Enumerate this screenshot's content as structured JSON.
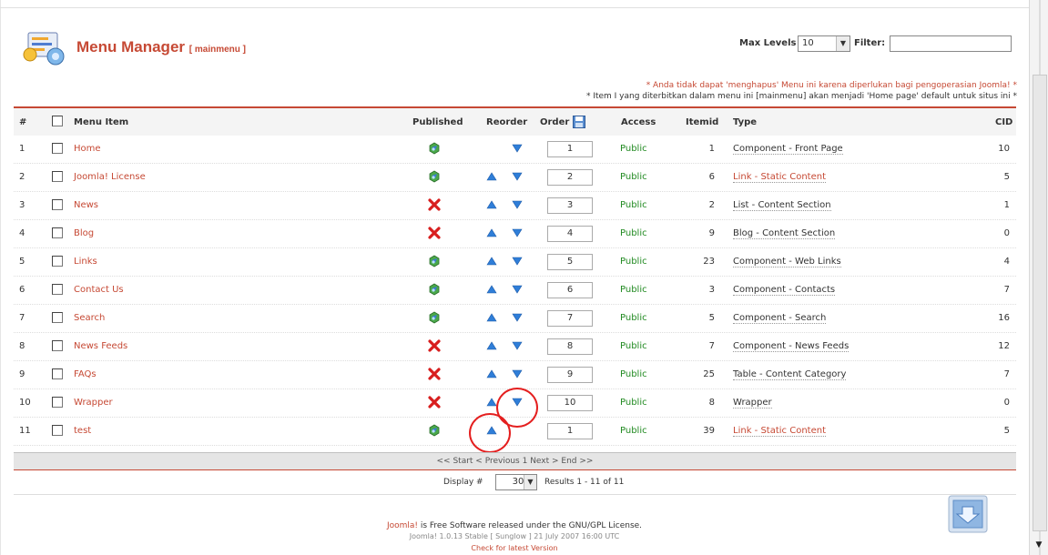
{
  "header": {
    "title": "Menu Manager",
    "subtitle": "[ mainmenu ]",
    "max_levels_label": "Max Levels",
    "max_levels_value": "10",
    "filter_label": "Filter:",
    "filter_value": ""
  },
  "notices": {
    "red": "* Anda tidak dapat 'menghapus' Menu ini karena diperlukan bagi pengoperasian Joomla! *",
    "dark": "* Item I yang diterbitkan dalam menu ini [mainmenu] akan menjadi 'Home page' default untuk situs ini *"
  },
  "columns": {
    "num": "#",
    "item": "Menu Item",
    "published": "Published",
    "reorder": "Reorder",
    "order": "Order",
    "access": "Access",
    "itemid": "Itemid",
    "type": "Type",
    "cid": "CID"
  },
  "rows": [
    {
      "num": "1",
      "name": "Home",
      "published": "yes",
      "up": false,
      "down": true,
      "order": "1",
      "access": "Public",
      "itemid": "1",
      "type": "Component - Front Page",
      "type_link": false,
      "cid": "10"
    },
    {
      "num": "2",
      "name": "Joomla! License",
      "published": "yes",
      "up": true,
      "down": true,
      "order": "2",
      "access": "Public",
      "itemid": "6",
      "type": "Link - Static Content",
      "type_link": true,
      "cid": "5"
    },
    {
      "num": "3",
      "name": "News",
      "published": "no",
      "up": true,
      "down": true,
      "order": "3",
      "access": "Public",
      "itemid": "2",
      "type": "List - Content Section",
      "type_link": false,
      "cid": "1"
    },
    {
      "num": "4",
      "name": "Blog",
      "published": "no",
      "up": true,
      "down": true,
      "order": "4",
      "access": "Public",
      "itemid": "9",
      "type": "Blog - Content Section",
      "type_link": false,
      "cid": "0"
    },
    {
      "num": "5",
      "name": "Links",
      "published": "yes",
      "up": true,
      "down": true,
      "order": "5",
      "access": "Public",
      "itemid": "23",
      "type": "Component - Web Links",
      "type_link": false,
      "cid": "4"
    },
    {
      "num": "6",
      "name": "Contact Us",
      "published": "yes",
      "up": true,
      "down": true,
      "order": "6",
      "access": "Public",
      "itemid": "3",
      "type": "Component - Contacts",
      "type_link": false,
      "cid": "7"
    },
    {
      "num": "7",
      "name": "Search",
      "published": "yes",
      "up": true,
      "down": true,
      "order": "7",
      "access": "Public",
      "itemid": "5",
      "type": "Component - Search",
      "type_link": false,
      "cid": "16"
    },
    {
      "num": "8",
      "name": "News Feeds",
      "published": "no",
      "up": true,
      "down": true,
      "order": "8",
      "access": "Public",
      "itemid": "7",
      "type": "Component - News Feeds",
      "type_link": false,
      "cid": "12"
    },
    {
      "num": "9",
      "name": "FAQs",
      "published": "no",
      "up": true,
      "down": true,
      "order": "9",
      "access": "Public",
      "itemid": "25",
      "type": "Table - Content Category",
      "type_link": false,
      "cid": "7"
    },
    {
      "num": "10",
      "name": "Wrapper",
      "published": "no",
      "up": true,
      "down": true,
      "order": "10",
      "access": "Public",
      "itemid": "8",
      "type": "Wrapper",
      "type_link": false,
      "cid": "0"
    },
    {
      "num": "11",
      "name": "test",
      "published": "yes",
      "up": true,
      "down": false,
      "order": "1",
      "access": "Public",
      "itemid": "39",
      "type": "Link - Static Content",
      "type_link": true,
      "cid": "5"
    }
  ],
  "pager": {
    "text": "<< Start < Previous 1 Next > End >>",
    "display_label": "Display #",
    "display_value": "30",
    "results": "Results 1 - 11 of 11"
  },
  "footer": {
    "joomla_link": "Joomla!",
    "line1_rest": " is Free Software released under the GNU/GPL License.",
    "line2": "Joomla! 1.0.13 Stable [ Sunglow ] 21 July 2007 16:00 UTC",
    "line3": "Check for latest Version"
  },
  "colors": {
    "accent": "#c64934",
    "access_green": "#218a21",
    "highlight_circle": "#e41f1f"
  }
}
